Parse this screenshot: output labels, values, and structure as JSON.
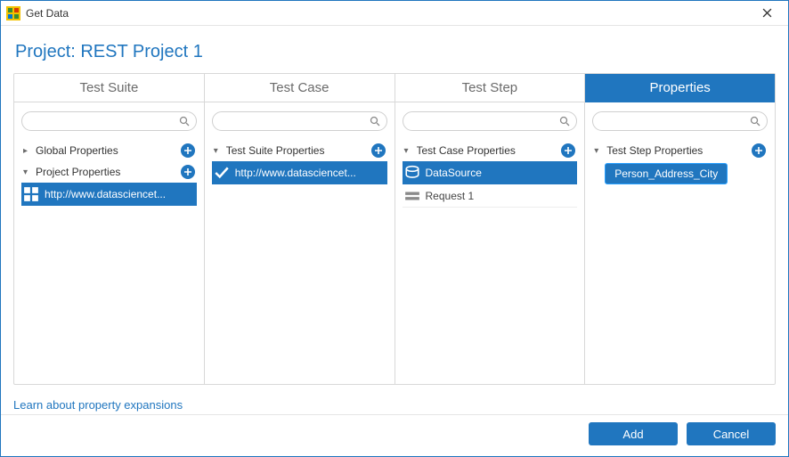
{
  "window": {
    "title": "Get Data"
  },
  "project_label": "Project: REST Project 1",
  "columns": {
    "test_suite": {
      "header": "Test Suite",
      "search_placeholder": "",
      "groups": [
        {
          "label": "Global Properties",
          "expanded": false
        },
        {
          "label": "Project Properties",
          "expanded": true
        }
      ],
      "items": [
        {
          "label": "http://www.datasciencet...",
          "icon": "grid-icon",
          "selected": true
        }
      ]
    },
    "test_case": {
      "header": "Test Case",
      "search_placeholder": "",
      "groups": [
        {
          "label": "Test Suite Properties",
          "expanded": true
        }
      ],
      "items": [
        {
          "label": "http://www.datasciencet...",
          "icon": "check-icon",
          "selected": true
        }
      ]
    },
    "test_step": {
      "header": "Test Step",
      "search_placeholder": "",
      "groups": [
        {
          "label": "Test Case Properties",
          "expanded": true
        }
      ],
      "items": [
        {
          "label": "DataSource",
          "icon": "datasource-icon",
          "selected": true
        },
        {
          "label": "Request 1",
          "icon": "request-icon",
          "selected": false
        }
      ]
    },
    "properties": {
      "header": "Properties",
      "search_placeholder": "",
      "groups": [
        {
          "label": "Test Step Properties",
          "expanded": true
        }
      ],
      "selected_property": "Person_Address_City"
    }
  },
  "footer_link": "Learn about property expansions",
  "buttons": {
    "add": "Add",
    "cancel": "Cancel"
  }
}
